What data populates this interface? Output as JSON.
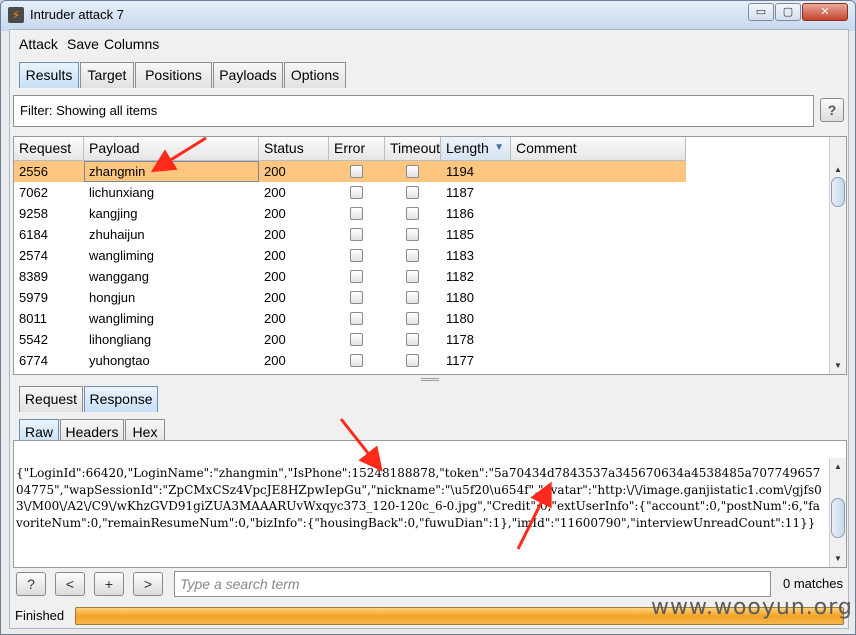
{
  "window": {
    "title": "Intruder attack 7",
    "min_glyph": "▭",
    "max_glyph": "▢",
    "close_glyph": "✕"
  },
  "menu": [
    "Attack",
    "Save",
    "Columns"
  ],
  "main_tabs": [
    "Results",
    "Target",
    "Positions",
    "Payloads",
    "Options"
  ],
  "active_main_tab": "Results",
  "filter": {
    "text": "Filter: Showing all items"
  },
  "help_label": "?",
  "table": {
    "columns": [
      "Request",
      "Payload",
      "Status",
      "Error",
      "Timeout",
      "Length",
      "Comment"
    ],
    "sorted_column": "Length",
    "sort_glyph": "▼",
    "rows": [
      {
        "request": "2556",
        "payload": "zhangmin",
        "status": "200",
        "length": "1194"
      },
      {
        "request": "7062",
        "payload": "lichunxiang",
        "status": "200",
        "length": "1187"
      },
      {
        "request": "9258",
        "payload": "kangjing",
        "status": "200",
        "length": "1186"
      },
      {
        "request": "6184",
        "payload": "zhuhaijun",
        "status": "200",
        "length": "1185"
      },
      {
        "request": "2574",
        "payload": "wangliming",
        "status": "200",
        "length": "1183"
      },
      {
        "request": "8389",
        "payload": "wanggang",
        "status": "200",
        "length": "1182"
      },
      {
        "request": "5979",
        "payload": "hongjun",
        "status": "200",
        "length": "1180"
      },
      {
        "request": "8011",
        "payload": "wangliming",
        "status": "200",
        "length": "1180"
      },
      {
        "request": "5542",
        "payload": "lihongliang",
        "status": "200",
        "length": "1178"
      },
      {
        "request": "6774",
        "payload": "yuhongtao",
        "status": "200",
        "length": "1177"
      }
    ],
    "selected_row": 0,
    "selected_color": "#ffc67f"
  },
  "detail_tabs": [
    "Request",
    "Response"
  ],
  "active_detail_tab": "Response",
  "view_tabs": [
    "Raw",
    "Headers",
    "Hex"
  ],
  "active_view_tab": "Raw",
  "response_raw": "{\"LoginId\":66420,\"LoginName\":\"zhangmin\",\"IsPhone\":15248188878,\"token\":\"5a70434d7843537a345670634a4538485a70774965704775\",\"wapSessionId\":\"ZpCMxCSz4VpcJE8HZpwIepGu\",\"nickname\":\"\\u5f20\\u654f\",\"avatar\":\"http:\\/\\/image.ganjistatic1.com\\/gjfs03\\/M00\\/A2\\/C9\\/wKhzGVD91giZUA3MAAARUvWxqyc373_120-120c_6-0.jpg\",\"Credit\":0,\"extUserInfo\":{\"account\":0,\"postNum\":6,\"favoriteNum\":0,\"remainResumeNum\":0,\"bizInfo\":{\"housingBack\":0,\"fuwuDian\":1},\"imId\":\"11600790\",\"interviewUnreadCount\":11}}",
  "search": {
    "help": "?",
    "prev": "<",
    "add": "+",
    "next": ">",
    "placeholder": "Type a search term",
    "matches": "0 matches"
  },
  "status": {
    "text": "Finished",
    "progress": 1.0
  },
  "watermark": "www.wooyun.org",
  "colors": {
    "accent": "#c7dff5",
    "progress": "#f3a226",
    "annotation_arrow": "#ff2a1a"
  }
}
